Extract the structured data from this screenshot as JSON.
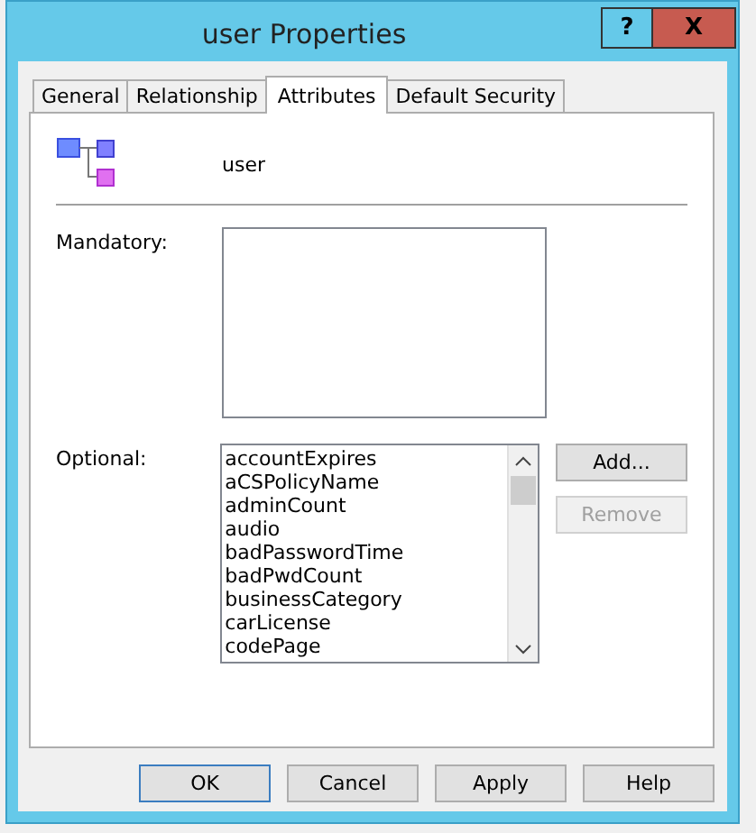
{
  "window": {
    "title": "user Properties",
    "help_button": "?",
    "close_button": "X"
  },
  "tabs": [
    {
      "label": "General",
      "selected": false
    },
    {
      "label": "Relationship",
      "selected": false
    },
    {
      "label": "Attributes",
      "selected": true
    },
    {
      "label": "Default Security",
      "selected": false
    }
  ],
  "class_name": "user",
  "mandatory": {
    "label": "Mandatory:"
  },
  "optional": {
    "label": "Optional:",
    "items": [
      "accountExpires",
      "aCSPolicyName",
      "adminCount",
      "audio",
      "badPasswordTime",
      "badPwdCount",
      "businessCategory",
      "carLicense",
      "codePage"
    ]
  },
  "side_buttons": [
    {
      "label": "Add...",
      "disabled": false
    },
    {
      "label": "Remove",
      "disabled": true
    }
  ],
  "buttons": [
    {
      "label": "OK",
      "default": true
    },
    {
      "label": "Cancel",
      "default": false
    },
    {
      "label": "Apply",
      "default": false
    },
    {
      "label": "Help",
      "default": false
    }
  ]
}
